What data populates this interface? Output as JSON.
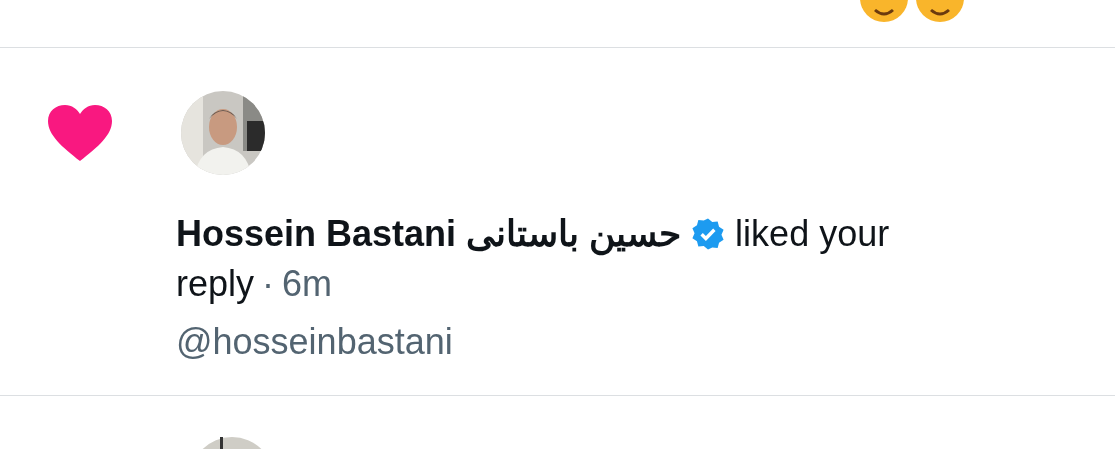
{
  "notifications": [
    {
      "kind": "like",
      "user": {
        "name": "Hossein Bastani حسین باستانی",
        "verified": true,
        "handle": "@hosseinbastani"
      },
      "action": "liked your",
      "object": "reply",
      "separator": "·",
      "time": "6m"
    }
  ]
}
